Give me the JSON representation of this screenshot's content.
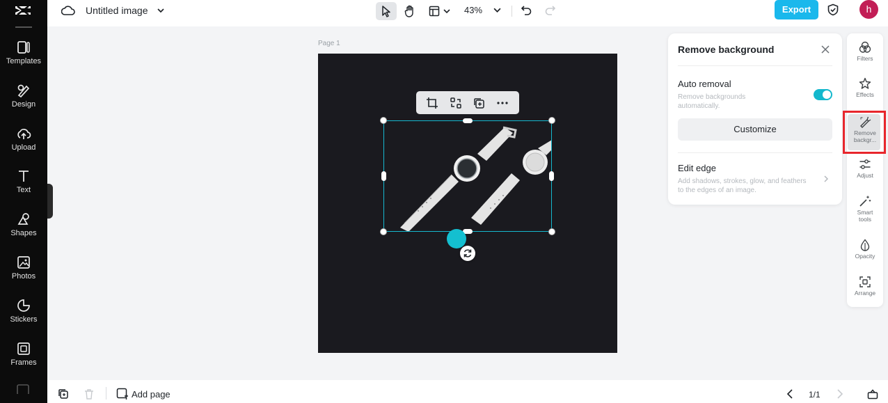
{
  "sidebar": {
    "logo": "capcut-logo",
    "items": [
      {
        "label": "Templates",
        "icon": "templates-icon"
      },
      {
        "label": "Design",
        "icon": "design-icon"
      },
      {
        "label": "Upload",
        "icon": "upload-icon"
      },
      {
        "label": "Text",
        "icon": "text-icon"
      },
      {
        "label": "Shapes",
        "icon": "shapes-icon"
      },
      {
        "label": "Photos",
        "icon": "photos-icon"
      },
      {
        "label": "Stickers",
        "icon": "stickers-icon"
      },
      {
        "label": "Frames",
        "icon": "frames-icon"
      }
    ]
  },
  "header": {
    "title": "Untitled image",
    "zoom": "43%",
    "export_label": "Export",
    "avatar_letter": "h"
  },
  "canvas": {
    "page_label": "Page 1"
  },
  "panel": {
    "title": "Remove background",
    "auto_removal": {
      "title": "Auto removal",
      "description": "Remove backgrounds automatically.",
      "enabled": true
    },
    "customize_label": "Customize",
    "edit_edge": {
      "title": "Edit edge",
      "description": "Add shadows, strokes, glow, and feathers to the edges of an image."
    }
  },
  "right_toolbar": {
    "items": [
      {
        "label": "Filters",
        "icon": "filters-icon"
      },
      {
        "label": "Effects",
        "icon": "effects-icon"
      },
      {
        "label": "Remove backgr...",
        "icon": "remove-background-icon",
        "active": true
      },
      {
        "label": "Adjust",
        "icon": "adjust-icon"
      },
      {
        "label": "Smart tools",
        "icon": "smart-tools-icon"
      },
      {
        "label": "Opacity",
        "icon": "opacity-icon"
      },
      {
        "label": "Arrange",
        "icon": "arrange-icon"
      }
    ]
  },
  "footer": {
    "add_page_label": "Add page",
    "page_indicator": "1/1"
  },
  "colors": {
    "accent": "#1ab8ec",
    "selection": "#16b9d0",
    "highlight": "#e8262c",
    "sidebar_bg": "#0c0c0c",
    "artboard_bg": "#1a1a1f",
    "avatar": "#c21e56"
  }
}
